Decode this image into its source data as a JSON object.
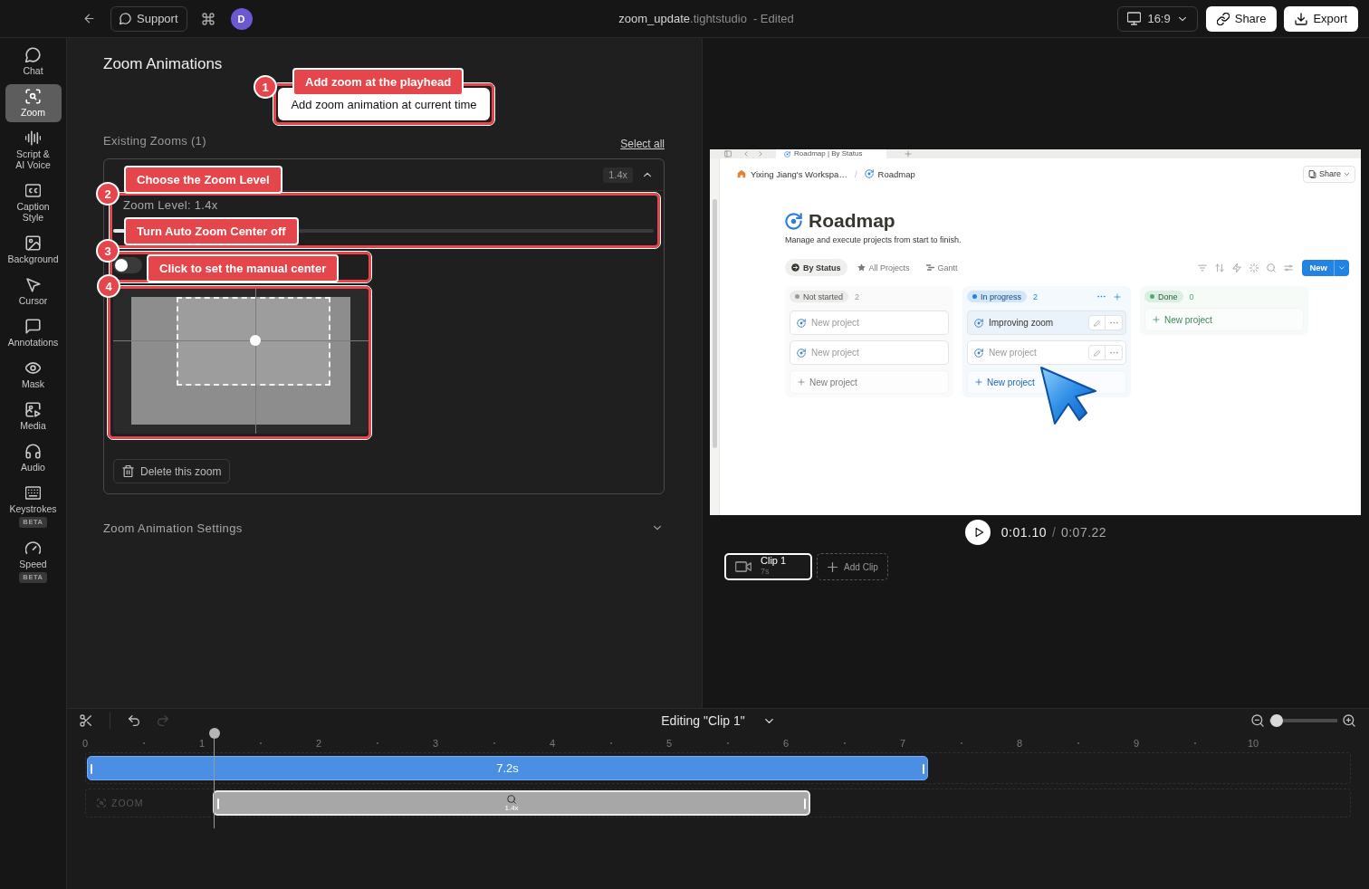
{
  "top_bar": {
    "support_button": "Support",
    "avatar": "D",
    "file_name": "zoom_update",
    "file_extension": ".tightstudio",
    "save_status": "- Edited",
    "aspect_ratio": "16:9",
    "share_button": "Share",
    "export_button": "Export"
  },
  "sidebar": {
    "items": [
      {
        "label": "Chat",
        "selected": false
      },
      {
        "label": "Zoom",
        "selected": true
      },
      {
        "label": "Script &\nAI Voice",
        "selected": false
      },
      {
        "label": "Caption\nStyle",
        "selected": false
      },
      {
        "label": "Background",
        "selected": false
      },
      {
        "label": "Cursor",
        "selected": false
      },
      {
        "label": "Annotations",
        "selected": false
      },
      {
        "label": "Mask",
        "selected": false
      },
      {
        "label": "Media",
        "selected": false
      },
      {
        "label": "Audio",
        "selected": false
      },
      {
        "label": "Keystrokes",
        "selected": false,
        "badge": "BETA"
      },
      {
        "label": "Speed",
        "selected": false,
        "badge": "BETA"
      }
    ]
  },
  "zoom_panel": {
    "title": "Zoom Animations",
    "add_button": "Add zoom animation at current time",
    "existing_label": "Existing Zooms (1)",
    "select_all": "Select all",
    "zooms": [
      {
        "expanded": true,
        "level_badge": "1.4x",
        "level_label": "Zoom Level: 1.4x",
        "level_slider": {
          "level": 0.03
        },
        "auto_center": {
          "on": false
        },
        "delete_button": "Delete this zoom"
      }
    ],
    "settings": {
      "label": "Zoom Animation Settings",
      "expanded": false
    }
  },
  "tutorial_steps": [
    {
      "number": "1",
      "text": "Add zoom at the playhead"
    },
    {
      "number": "2",
      "text": "Choose the Zoom Level"
    },
    {
      "number": "3",
      "text": "Turn Auto Zoom Center off"
    },
    {
      "number": "4",
      "text": "Click to set the manual center"
    }
  ],
  "preview": {
    "app_window": {
      "tab": "Roadmap | By Status",
      "breadcrumbs": [
        "Yixing Jiang's Workspa…",
        "Roadmap"
      ],
      "breadcrumb_separator": "/",
      "share_button": "Share",
      "title": "Roadmap",
      "description": "Manage and execute projects from start to finish.",
      "views": [
        {
          "label": "By Status",
          "selected": true
        },
        {
          "label": "All Projects",
          "selected": false
        },
        {
          "label": "Gantt",
          "selected": false
        }
      ],
      "new_button": "New",
      "columns": [
        {
          "status": "Not started",
          "count": "2",
          "color": "#9b9a97",
          "header_actions": false,
          "cards": [
            {
              "title": "New project",
              "untitled": true,
              "highlighted": false,
              "actions_visible": false
            },
            {
              "title": "New project",
              "untitled": true,
              "highlighted": false,
              "actions_visible": false
            }
          ],
          "add_label": "New project"
        },
        {
          "status": "In progress",
          "count": "2",
          "color": "#2383e2",
          "header_actions": true,
          "cards": [
            {
              "title": "Improving zoom",
              "untitled": false,
              "highlighted": true,
              "actions_visible": true
            },
            {
              "title": "New project",
              "untitled": true,
              "highlighted": false,
              "actions_visible": true
            }
          ],
          "add_label": "New project"
        },
        {
          "status": "Done",
          "count": "0",
          "color": "#4dab6f",
          "header_actions": false,
          "add_label": "New project"
        }
      ]
    },
    "playing": false,
    "current_time": "0:01.10",
    "time_separator": "/",
    "total_time": "0:07.22",
    "clips": [
      {
        "name": "Clip 1",
        "duration": "7s",
        "selected": true
      }
    ],
    "add_clip": "Add Clip"
  },
  "timeline": {
    "tools": [
      {
        "kind": "cut",
        "disabled": false
      },
      {
        "kind": "undo",
        "disabled": false
      },
      {
        "kind": "redo",
        "disabled": true
      }
    ],
    "editing_label": "Editing \"Clip 1\"",
    "zoom_slider": {
      "level": 0.02
    },
    "ruler": [
      "0",
      "1",
      "2",
      "3",
      "4",
      "5",
      "6",
      "7",
      "8",
      "9",
      "10"
    ],
    "playhead": {
      "level": 0.102
    },
    "tracks": [
      {
        "kind": "video",
        "clip_label": "7.2s"
      },
      {
        "kind": "zoom",
        "label": "ZOOM",
        "clip_label": "1.4x"
      }
    ]
  }
}
